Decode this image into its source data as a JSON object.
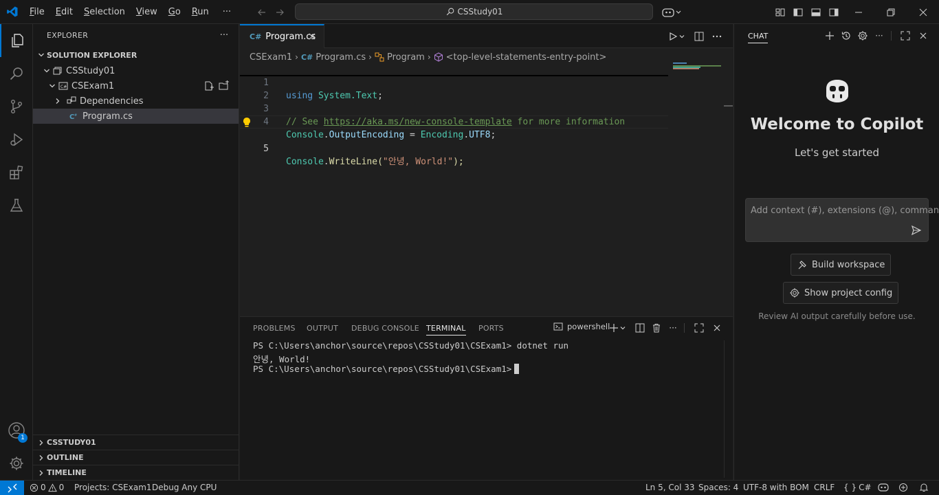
{
  "titlebar": {
    "menu": [
      "File",
      "Edit",
      "Selection",
      "View",
      "Go",
      "Run"
    ],
    "more": "···",
    "search_text": "CSStudy01"
  },
  "sidebar": {
    "title": "EXPLORER",
    "more": "···",
    "section": "SOLUTION EXPLORER",
    "tree": [
      {
        "label": "CSStudy01"
      },
      {
        "label": "CSExam1"
      },
      {
        "label": "Dependencies"
      },
      {
        "label": "Program.cs"
      }
    ],
    "bottom_sections": [
      "CSSTUDY01",
      "OUTLINE",
      "TIMELINE"
    ]
  },
  "activity": {
    "accounts_badge": "1"
  },
  "editor": {
    "tab": {
      "icon_text": "C#",
      "label": "Program.cs"
    },
    "breadcrumbs": [
      "CSExam1",
      "Program.cs",
      "Program",
      "<top-level-statements-entry-point>"
    ],
    "line_numbers": [
      "1",
      "2",
      "3",
      "4",
      "5"
    ],
    "code": {
      "l1_kw": "using",
      "l1_ns": "System.Text",
      "l1_end": ";",
      "l3_comment_a": "// See ",
      "l3_link": "https://aka.ms/new-console-template",
      "l3_comment_b": " for more information",
      "l4_a": "Console",
      "l4_dot1": ".",
      "l4_b": "OutputEncoding",
      "l4_eq": " = ",
      "l4_c": "Encoding",
      "l4_dot2": ".",
      "l4_d": "UTF8",
      "l4_end": ";",
      "l5_a": "Console",
      "l5_dot": ".",
      "l5_b": "WriteLine",
      "l5_p1": "(",
      "l5_str": "\"안녕, World!\"",
      "l5_p2": ");"
    }
  },
  "panel": {
    "tabs": [
      "PROBLEMS",
      "OUTPUT",
      "DEBUG CONSOLE",
      "TERMINAL",
      "PORTS"
    ],
    "active_tab": "TERMINAL",
    "terminal_name": "powershell",
    "more": "···",
    "terminal_lines": [
      "PS C:\\Users\\anchor\\source\\repos\\CSStudy01\\CSExam1> dotnet run",
      "안녕, World!",
      "PS C:\\Users\\anchor\\source\\repos\\CSStudy01\\CSExam1>"
    ]
  },
  "chat": {
    "tab": "CHAT",
    "more": "···",
    "welcome_title": "Welcome to Copilot",
    "welcome_sub": "Let's get started",
    "input_placeholder": "Add context (#), extensions (@), commands",
    "build_button": "Build workspace",
    "config_button": "Show project config",
    "disclaimer": "Review AI output carefully before use."
  },
  "statusbar": {
    "errors": "0",
    "warnings": "0",
    "projects": "Projects: CSExam1",
    "debug": "Debug Any CPU",
    "position": "Ln 5, Col 33",
    "spaces": "Spaces: 4",
    "encoding": "UTF-8 with BOM",
    "eol": "CRLF",
    "language": "C#",
    "brackets": "{ }"
  },
  "colors": {
    "accent": "#0078d4",
    "editor_bg": "#1f1f1f",
    "chrome_bg": "#181818"
  }
}
